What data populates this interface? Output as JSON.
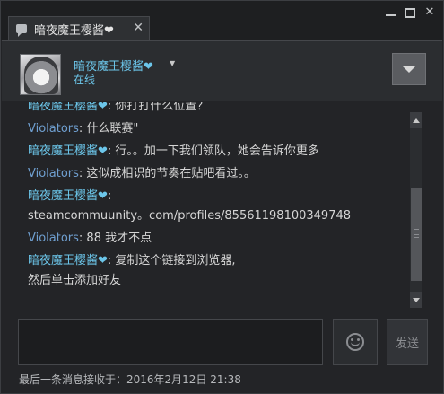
{
  "tab": {
    "title": "暗夜魔王樱酱❤",
    "close": "✕"
  },
  "window_controls": {
    "close": "✕"
  },
  "friend": {
    "name": "暗夜魔王樱酱❤",
    "status": "在线"
  },
  "messages": [
    {
      "sender": "暗夜魔王樱酱❤",
      "text": ": 你打打什么位置？",
      "sender_color": "#6cc6ea"
    },
    {
      "sender": "Violators",
      "text": ": 什么联赛\"",
      "sender_color": "#6f9fd0"
    },
    {
      "sender": "暗夜魔王樱酱❤",
      "text": ": 行。。加一下我们领队，她会告诉你更多",
      "sender_color": "#6cc6ea"
    },
    {
      "sender": "Violators",
      "text": ": 这似成相识的节奏在贴吧看过。。",
      "sender_color": "#6f9fd0"
    },
    {
      "sender": "暗夜魔王樱酱❤",
      "text": ":",
      "sender_color": "#6cc6ea"
    },
    {
      "sender": "",
      "text": "steamcommuunity。com/profiles/85561198100349748",
      "sender_color": "#6cc6ea"
    },
    {
      "sender": "Violators",
      "text": ": 88 我才不点",
      "sender_color": "#6f9fd0"
    },
    {
      "sender": "暗夜魔王樱酱❤",
      "text": ": 复制这个链接到浏览器,",
      "sender_color": "#6cc6ea"
    },
    {
      "sender": "",
      "text": "然后单击添加好友",
      "sender_color": "#6cc6ea"
    }
  ],
  "input": {
    "value": "",
    "placeholder": ""
  },
  "send_button": {
    "label": "发送"
  },
  "footer": {
    "last_received": "最后一条消息接收于：2016年2月12日 21:38"
  }
}
